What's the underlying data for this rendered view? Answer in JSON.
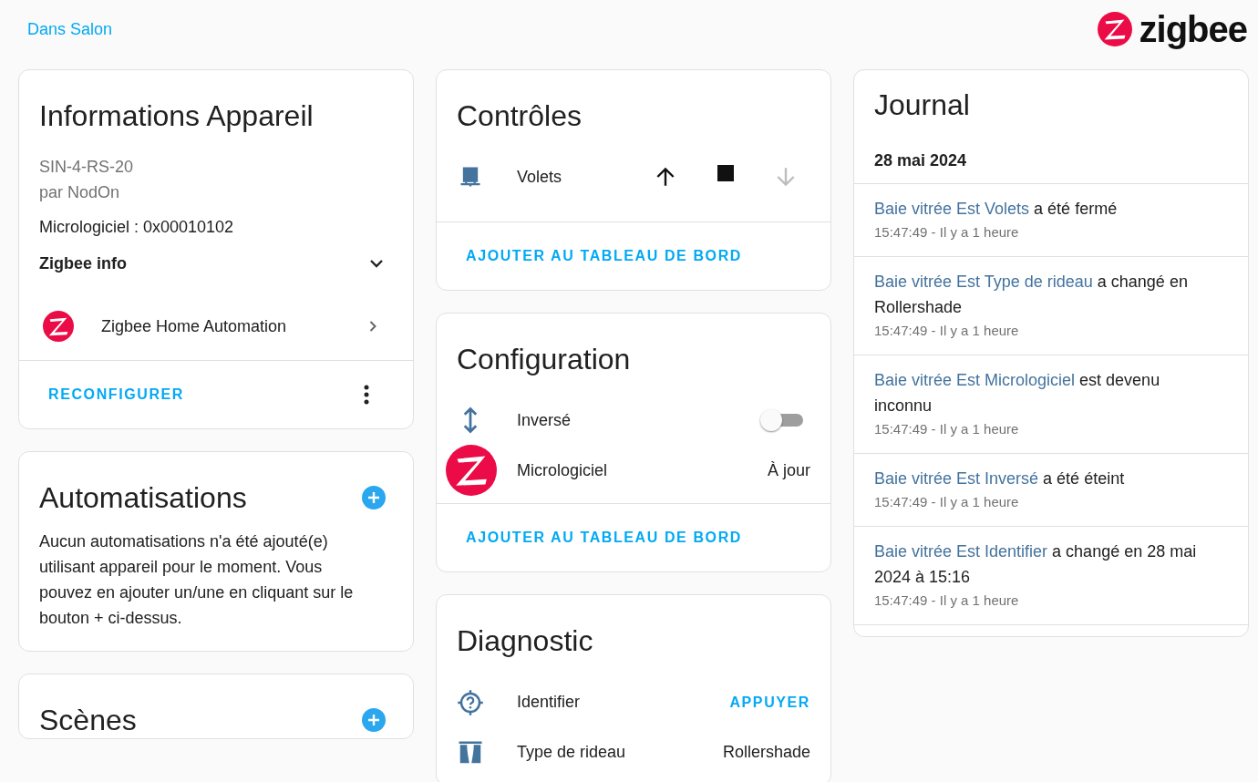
{
  "breadcrumb": "Dans Salon",
  "brand": {
    "name": "zigbee"
  },
  "device_info": {
    "title": "Informations Appareil",
    "model": "SIN-4-RS-20",
    "manufacturer": "par NodOn",
    "firmware": "Micrologiciel : 0x00010102",
    "zigbee_info": {
      "label": "Zigbee info",
      "expanded": false
    },
    "integration": "Zigbee Home Automation",
    "action": "RECONFIGURER"
  },
  "automations": {
    "title": "Automatisations",
    "text": "Aucun automatisations n'a été ajouté(e) utilisant appareil pour le moment. Vous pouvez en ajouter un/une en cliquant sur le bouton + ci-dessus."
  },
  "scenes": {
    "title": "Scènes"
  },
  "controls": {
    "title": "Contrôles",
    "entity": "Volets",
    "buttons": [
      {
        "kind": "up",
        "disabled": false
      },
      {
        "kind": "stop",
        "disabled": false
      },
      {
        "kind": "down",
        "disabled": true
      }
    ],
    "action": "AJOUTER AU TABLEAU DE BORD"
  },
  "configuration": {
    "title": "Configuration",
    "rows": [
      {
        "kind": "switch",
        "label": "Inversé",
        "on": false
      },
      {
        "kind": "value",
        "label": "Micrologiciel",
        "value": "À jour"
      }
    ],
    "action": "AJOUTER AU TABLEAU DE BORD"
  },
  "diagnostic": {
    "title": "Diagnostic",
    "rows": [
      {
        "kind": "button",
        "label": "Identifier",
        "value": "APPUYER"
      },
      {
        "kind": "value",
        "label": "Type de rideau",
        "value": "Rollershade"
      }
    ]
  },
  "journal": {
    "title": "Journal",
    "date": "28 mai 2024",
    "entries": [
      {
        "entity": "Baie vitrée Est Volets",
        "message": "a été fermé",
        "time": "15:47:49 - Il y a 1 heure"
      },
      {
        "entity": "Baie vitrée Est Type de rideau",
        "message": "a changé en Rollershade",
        "time": "15:47:49 - Il y a 1 heure"
      },
      {
        "entity": "Baie vitrée Est Micrologiciel",
        "message": "est devenu inconnu",
        "time": "15:47:49 - Il y a 1 heure"
      },
      {
        "entity": "Baie vitrée Est Inversé",
        "message": "a été éteint",
        "time": "15:47:49 - Il y a 1 heure"
      },
      {
        "entity": "Baie vitrée Est Identifier",
        "message": "a changé en 28 mai 2024 à 15:16",
        "time": "15:47:49 - Il y a 1 heure"
      }
    ]
  }
}
